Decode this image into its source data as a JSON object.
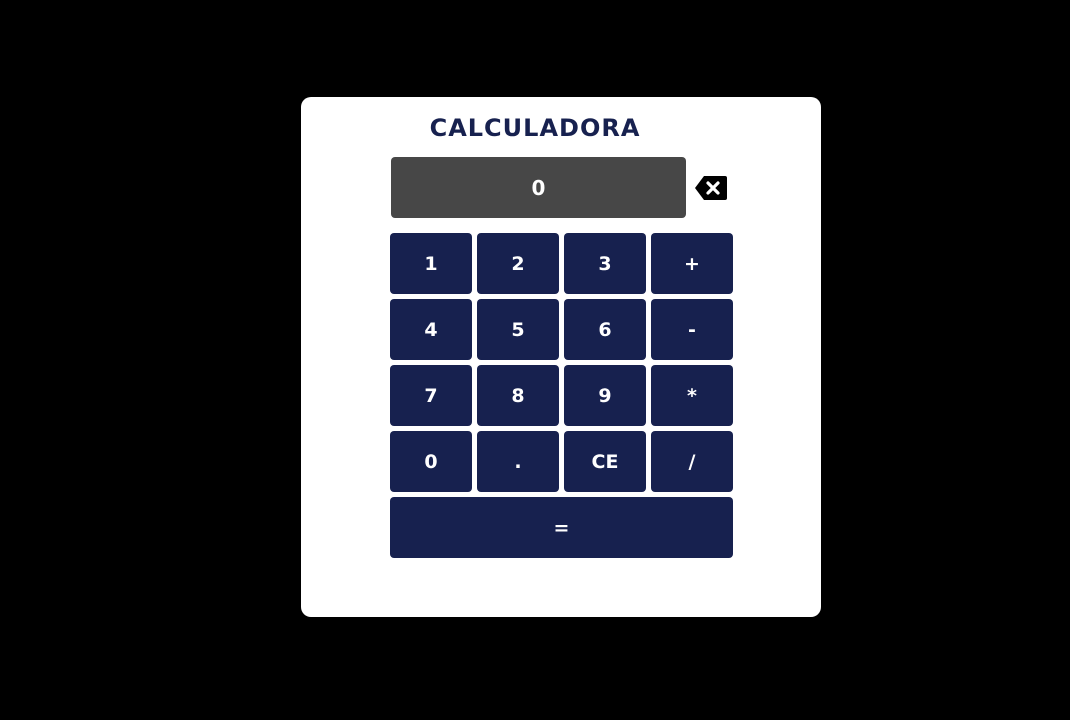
{
  "app": {
    "title": "CALCULADORA"
  },
  "display": {
    "value": "0"
  },
  "icons": {
    "backspace": "backspace-icon"
  },
  "keys": {
    "one": "1",
    "two": "2",
    "three": "3",
    "plus": "+",
    "four": "4",
    "five": "5",
    "six": "6",
    "minus": "-",
    "seven": "7",
    "eight": "8",
    "nine": "9",
    "multiply": "*",
    "zero": "0",
    "dot": ".",
    "clear_entry": "CE",
    "divide": "/",
    "equals": "="
  },
  "colors": {
    "background": "#000000",
    "card": "#ffffff",
    "accent": "#17214f",
    "display": "#474747",
    "key_text": "#ffffff"
  }
}
